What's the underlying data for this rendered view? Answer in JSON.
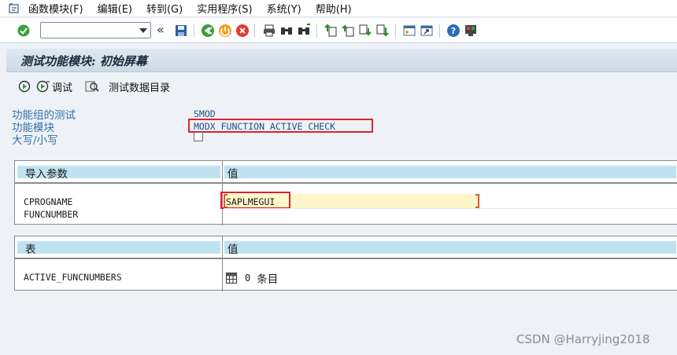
{
  "menu": {
    "items": [
      "函数模块(F)",
      "编辑(E)",
      "转到(G)",
      "实用程序(S)",
      "系统(Y)",
      "帮助(H)"
    ]
  },
  "toolbar": {
    "command_field": "",
    "icons": [
      "enter-icon",
      "save-icon",
      "back-icon",
      "exit-icon",
      "cancel-icon",
      "print-icon",
      "find-icon",
      "find-next-icon",
      "first-page-icon",
      "previous-page-icon",
      "next-page-icon",
      "last-page-icon",
      "create-session-icon",
      "shortcut-icon",
      "help-icon",
      "customize-layout-icon"
    ]
  },
  "screen": {
    "title": "测试功能模块: 初始屏幕"
  },
  "app_toolbar": {
    "execute_label": "",
    "debug_label": "调试",
    "test_data_label": "测试数据目录"
  },
  "header": {
    "func_group_label": "功能组的测试",
    "func_group_value": "SMOD",
    "func_module_label": "功能模块",
    "func_module_value": "MODX_FUNCTION_ACTIVE_CHECK",
    "case_label": "大写/小写"
  },
  "import_table": {
    "col1": "导入参数",
    "col2": "值",
    "rows": [
      {
        "name": "CPROGNAME",
        "value": "SAPLMEGUI"
      },
      {
        "name": "FUNCNUMBER",
        "value": ""
      }
    ]
  },
  "tables_table": {
    "col1": "表",
    "col2": "值",
    "rows": [
      {
        "name": "ACTIVE_FUNCNUMBERS",
        "count": "0",
        "unit": "条目"
      }
    ]
  },
  "watermark": "CSDN @Harryjing2018",
  "colors": {
    "header_cell": "#bfe2f0",
    "highlight_border": "#e0202b",
    "input_fill": "#fff6c9",
    "label_blue": "#2f6fa6"
  }
}
